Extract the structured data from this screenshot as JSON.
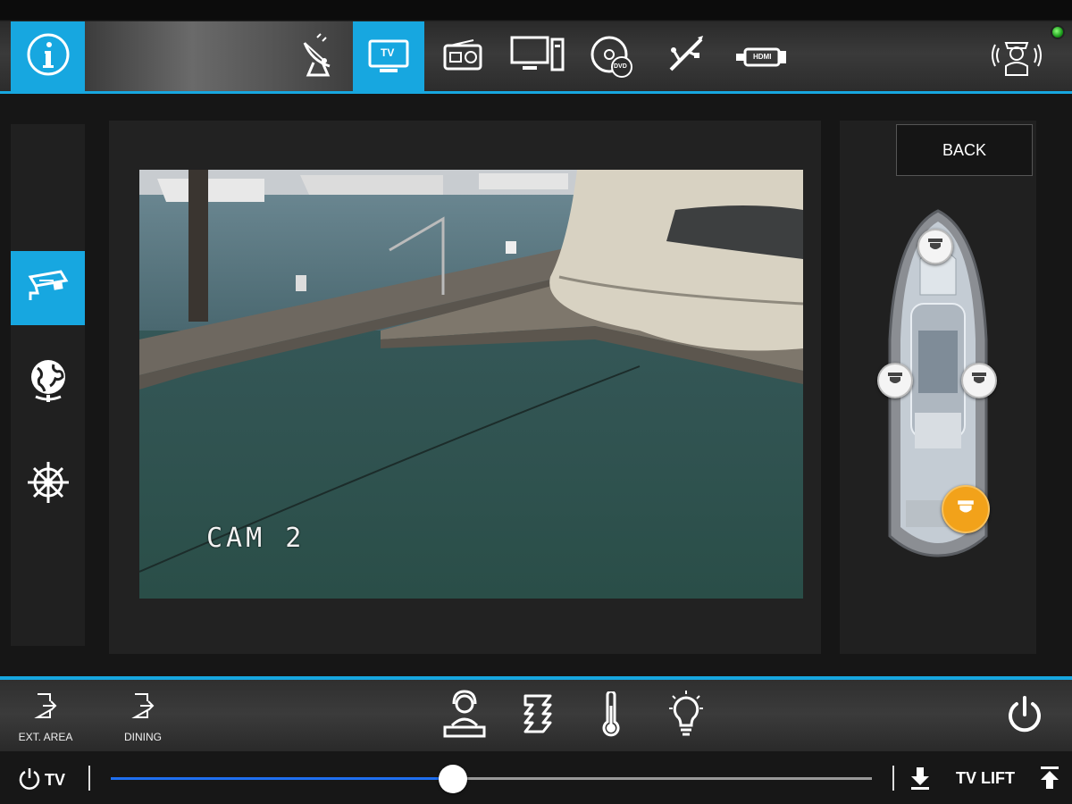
{
  "top_nav": {
    "items": [
      {
        "icon": "info-icon"
      },
      {
        "icon": "satellite-dish-icon"
      },
      {
        "icon": "apple-tv-icon",
        "label": "TV",
        "active": true
      },
      {
        "icon": "radio-icon"
      },
      {
        "icon": "desktop-computer-icon"
      },
      {
        "icon": "dvd-icon",
        "label": "DVD"
      },
      {
        "icon": "usb-icon"
      },
      {
        "icon": "hdmi-icon",
        "label": "HDMI"
      },
      {
        "icon": "crew-call-icon"
      }
    ],
    "status_color": "#22c322"
  },
  "side_nav": {
    "items": [
      {
        "icon": "security-camera-icon",
        "active": true
      },
      {
        "icon": "globe-icon"
      },
      {
        "icon": "ship-wheel-icon"
      }
    ]
  },
  "camera": {
    "overlay_label": "CAM 2"
  },
  "camera_map": {
    "back_label": "BACK",
    "cameras": [
      {
        "id": "bow",
        "active": false
      },
      {
        "id": "port",
        "active": false
      },
      {
        "id": "starboard",
        "active": false
      },
      {
        "id": "stern",
        "active": true
      }
    ]
  },
  "bottom_nav": {
    "rooms": [
      {
        "label": "EXT. AREA"
      },
      {
        "label": "DINING"
      }
    ],
    "icons": [
      "crew-station-icon",
      "blinds-icon",
      "thermometer-icon",
      "light-bulb-icon"
    ],
    "power_icon": "power-icon"
  },
  "tv_lift": {
    "power_label": "TV",
    "lift_label": "TV LIFT",
    "volume_fraction": 0.45
  },
  "colors": {
    "accent": "#17a7e0",
    "active_camera": "#f2a21a",
    "slider_fill": "#1f6ff0"
  }
}
